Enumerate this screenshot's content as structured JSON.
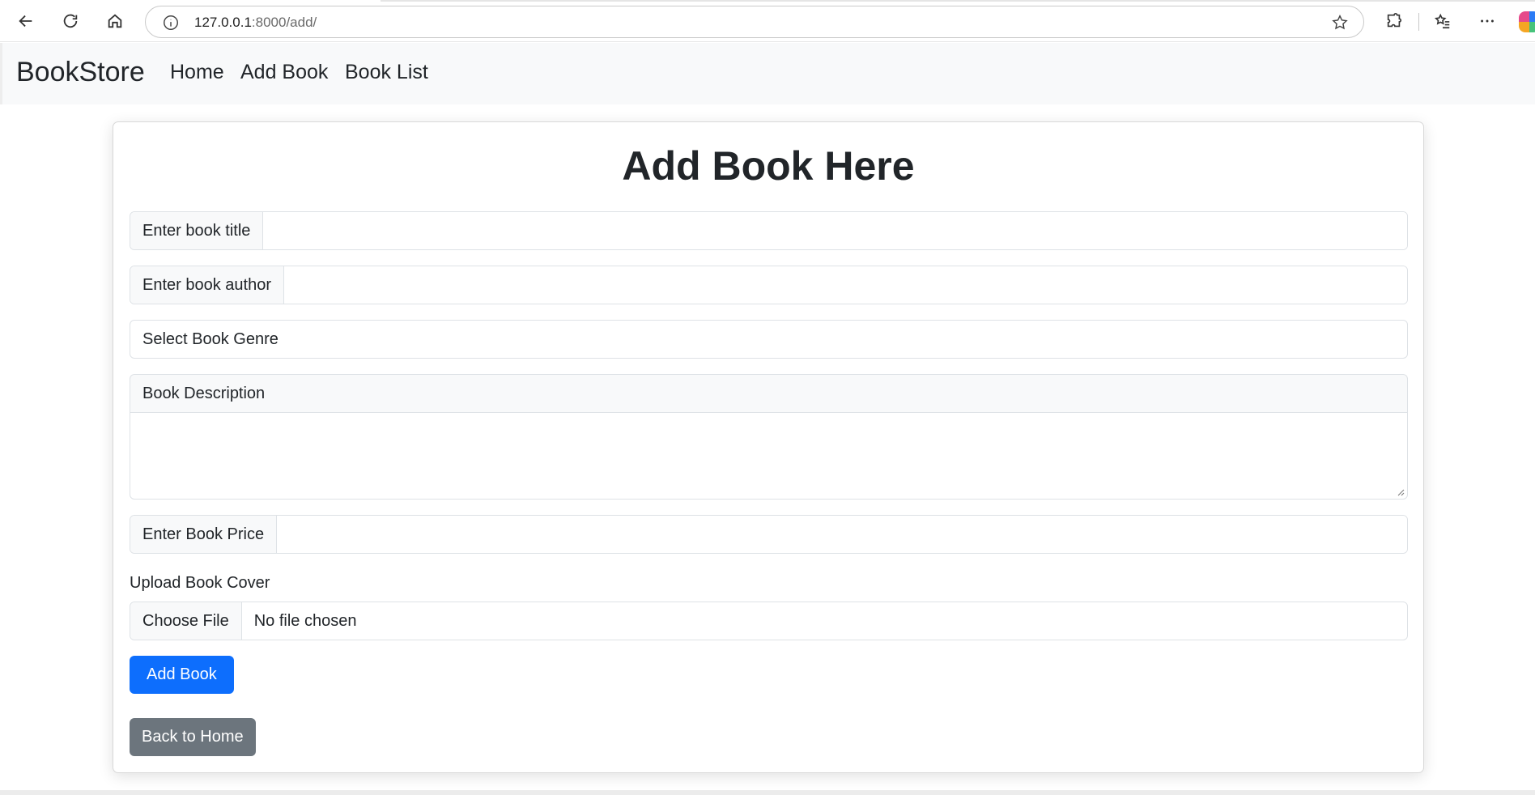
{
  "browser": {
    "url_host": "127.0.0.1",
    "url_rest": ":8000/add/"
  },
  "navbar": {
    "brand": "BookStore",
    "links": [
      "Home",
      "Add Book",
      "Book List"
    ]
  },
  "form": {
    "title": "Add Book Here",
    "title_label": "Enter book title",
    "author_label": "Enter book author",
    "genre_placeholder": "Select Book Genre",
    "description_label": "Book Description",
    "price_label": "Enter Book Price",
    "upload_label": "Upload Book Cover",
    "file_button": "Choose File",
    "file_status": "No file chosen",
    "submit_label": "Add Book",
    "back_label": "Back to Home"
  },
  "colors": {
    "primary": "#0d6efd",
    "secondary": "#6c757d",
    "navbar_bg": "#f8f9fa"
  }
}
